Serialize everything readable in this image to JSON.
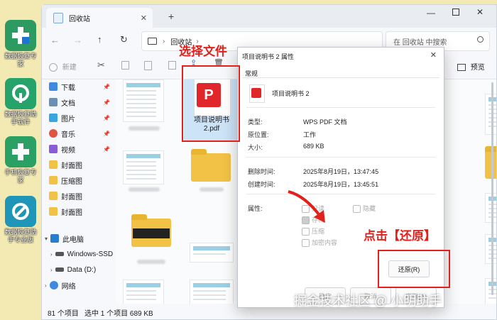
{
  "desktop": {
    "icons": [
      {
        "label": "数据恢复专家",
        "color": "#2d9a61"
      },
      {
        "label": "数据恢复助手软件",
        "color": "#26a36a"
      },
      {
        "label": "手机恢复专家",
        "color": "#2aa065"
      },
      {
        "label": "数据恢复助手专业版",
        "color": "#1f95b8"
      }
    ]
  },
  "explorer": {
    "tab_title": "回收站",
    "path": "回收站",
    "search_placeholder": "在 回收站 中搜索",
    "toolbar": {
      "new_label": "新建",
      "preview_label": "预览"
    },
    "sidebar": {
      "quick": [
        {
          "label": "下载",
          "pinned": true
        },
        {
          "label": "文档",
          "pinned": true
        },
        {
          "label": "图片",
          "pinned": true
        },
        {
          "label": "音乐",
          "pinned": true
        },
        {
          "label": "视频",
          "pinned": true
        },
        {
          "label": "封面图",
          "pinned": false
        },
        {
          "label": "压缩图",
          "pinned": false
        },
        {
          "label": "封面图",
          "pinned": false
        },
        {
          "label": "封面图",
          "pinned": false
        }
      ],
      "this_pc": "此电脑",
      "drives": [
        "Windows-SSD",
        "Data (D:)"
      ],
      "network": "网络"
    },
    "selected_file": {
      "name_line1": "项目说明书",
      "name_line2": "2.pdf",
      "icon_text": "P"
    },
    "status": {
      "count": "81 个项目",
      "selection": "选中 1 个项目  689 KB"
    }
  },
  "dialog": {
    "title": "项目说明书 2 属性",
    "tab": "常规",
    "filename": "项目说明书 2",
    "fields": [
      {
        "label": "类型:",
        "value": "WPS PDF 文档"
      },
      {
        "label": "原位置:",
        "value": "工作"
      },
      {
        "label": "大小:",
        "value": "689 KB"
      },
      {
        "label": "删除时间:",
        "value": "2025年8月19日，13:47:45"
      },
      {
        "label": "创建时间:",
        "value": "2025年8月19日，13:45:51"
      }
    ],
    "attributes_label": "属性:",
    "attributes": {
      "readonly": "只读",
      "hidden": "隐藏",
      "archive": "存档",
      "compress": "压缩",
      "encrypt": "加密内容"
    },
    "restore_button": "还原(R)",
    "ok_button": "确定",
    "cancel_button": "取消",
    "apply_button": "应用(A)"
  },
  "annotations": {
    "select_file": "选择文件",
    "click_restore": "点击【还原】"
  },
  "watermark": "掘金技术社区 @ 小明助手",
  "colors": {
    "annotation_red": "#e3211c",
    "folder_yellow": "#f2c247",
    "pdf_red": "#e0262a"
  }
}
